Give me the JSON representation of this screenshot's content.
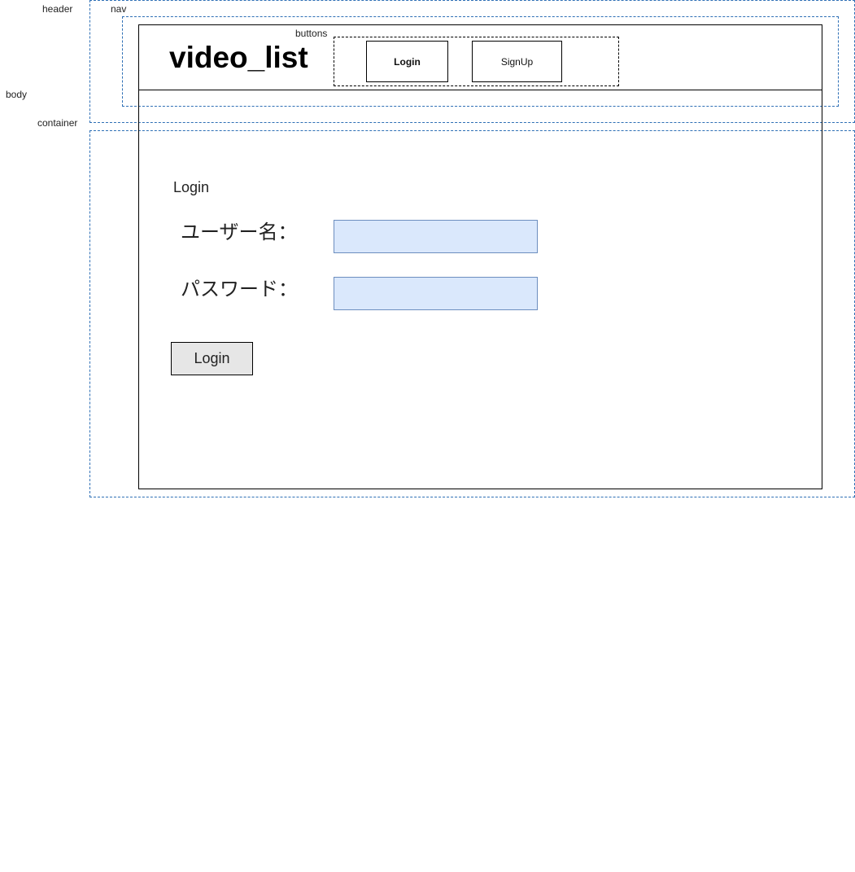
{
  "annotations": {
    "header": "header",
    "nav": "nav",
    "body": "body",
    "container": "container",
    "buttons": "buttons"
  },
  "header": {
    "site_title": "video_list",
    "login_button": "Login",
    "signup_button": "SignUp"
  },
  "login_form": {
    "heading": "Login",
    "username_label": "ユーザー名：",
    "username_value": "",
    "password_label": "パスワード：",
    "password_value": "",
    "submit_button": "Login"
  },
  "colors": {
    "region_border": "#2e6fb5",
    "input_fill": "#dae8fc",
    "input_border": "#6c8ebf",
    "submit_fill": "#e6e6e6"
  }
}
